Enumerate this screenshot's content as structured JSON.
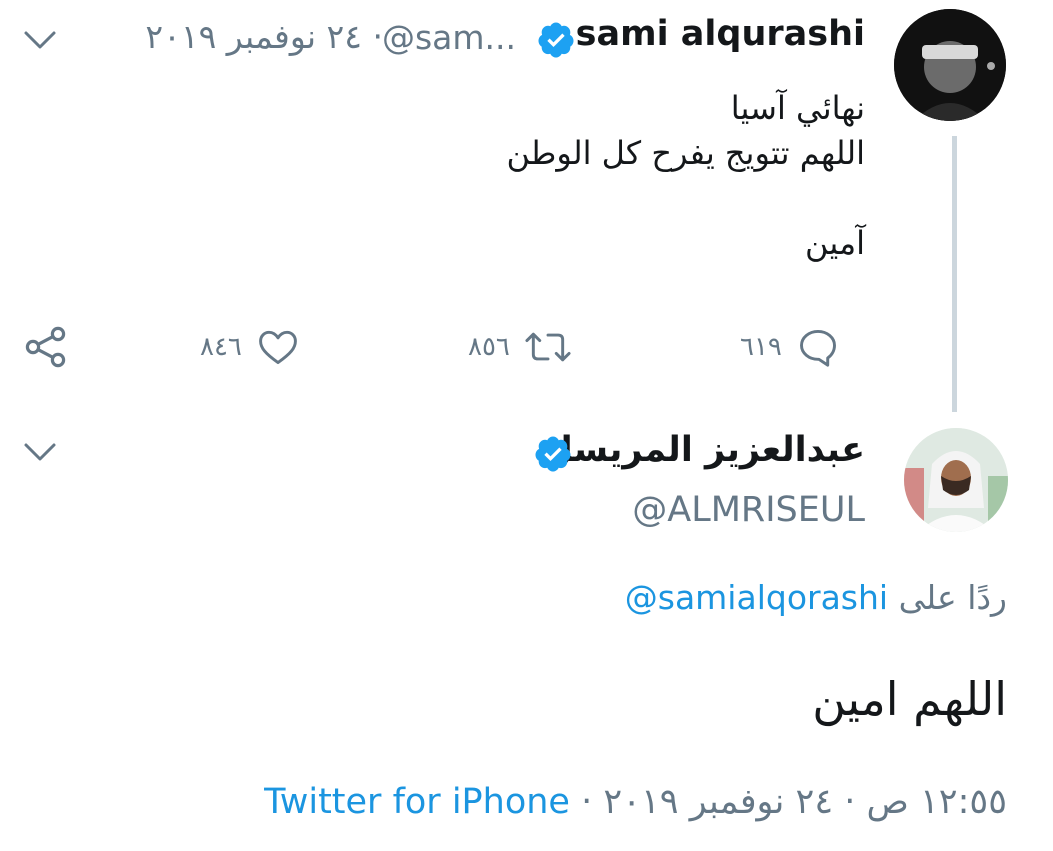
{
  "parent_tweet": {
    "author_name": "sami alqurashi",
    "author_handle": "@sam...",
    "separator": "·",
    "date": "٢٤ نوفمبر ٢٠١٩",
    "text": "نهائي آسيا\nاللهم تتويج يفرح كل الوطن\n\nآمين",
    "reply_count": "٦١٩",
    "retweet_count": "٨٥٦",
    "like_count": "٨٤٦"
  },
  "reply_tweet": {
    "author_name": "عبدالعزيز المريسل",
    "author_handle": "@ALMRISEUL",
    "replying_to_label": "ردًا على",
    "replying_to_handle": "@samialqorashi",
    "text": "اللهم امين",
    "time": "١٢:٥٥ ص",
    "date": "٢٤ نوفمبر ٢٠١٩",
    "separator": "·",
    "source": "Twitter for iPhone"
  },
  "colors": {
    "verified_blue": "#1da1f2",
    "link_blue": "#1b95e0",
    "secondary_text": "#657786",
    "thread_line": "#ccd6dd"
  },
  "icons": [
    "chevron-down-icon",
    "verified-badge-icon",
    "reply-icon",
    "retweet-icon",
    "like-icon",
    "share-icon"
  ]
}
